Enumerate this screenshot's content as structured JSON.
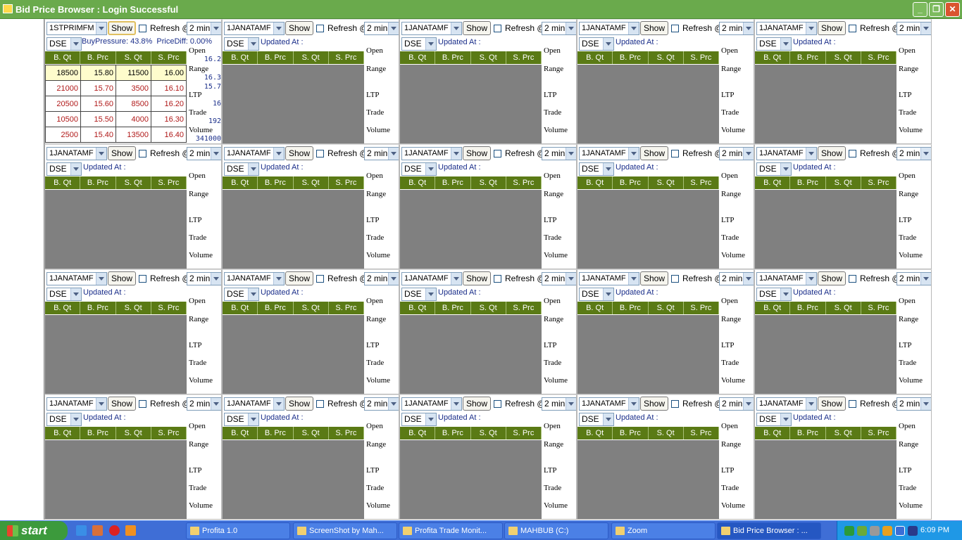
{
  "window": {
    "title": "Bid Price Browser : Login Successful"
  },
  "labels": {
    "show": "Show",
    "refresh": "Refresh @",
    "headers": [
      "B. Qt",
      "B. Prc",
      "S. Qt",
      "S. Prc"
    ],
    "open": "Open",
    "range": "Range",
    "ltp": "LTP",
    "trade": "Trade",
    "volume": "Volume",
    "updated_at": "Updated At :"
  },
  "first_panel": {
    "symbol": "1STPRIMFM",
    "exchange": "DSE",
    "interval": "2 min",
    "buy_pressure": "BuyPressure: 43.8%",
    "price_diff": "PriceDiff: 0.00%",
    "open": "16.2",
    "range_high": "16.3",
    "range_low": "15.7",
    "ltp": "16",
    "trade": "192",
    "volume": "341000",
    "rows": [
      [
        "18500",
        "15.80",
        "11500",
        "16.00"
      ],
      [
        "21000",
        "15.70",
        "3500",
        "16.10"
      ],
      [
        "20500",
        "15.60",
        "8500",
        "16.20"
      ],
      [
        "10500",
        "15.50",
        "4000",
        "16.30"
      ],
      [
        "2500",
        "15.40",
        "13500",
        "16.40"
      ]
    ]
  },
  "panel_defaults": {
    "symbol": "1JANATAMF",
    "exchange": "DSE",
    "interval": "2 min"
  },
  "taskbar": {
    "start": "start",
    "tasks": [
      "Profita 1.0",
      "ScreenShot by Mah...",
      "Profita Trade Monit...",
      "MAHBUB (C:)",
      "Zoom",
      "Bid Price Browser : ..."
    ],
    "clock": "6:09 PM"
  }
}
